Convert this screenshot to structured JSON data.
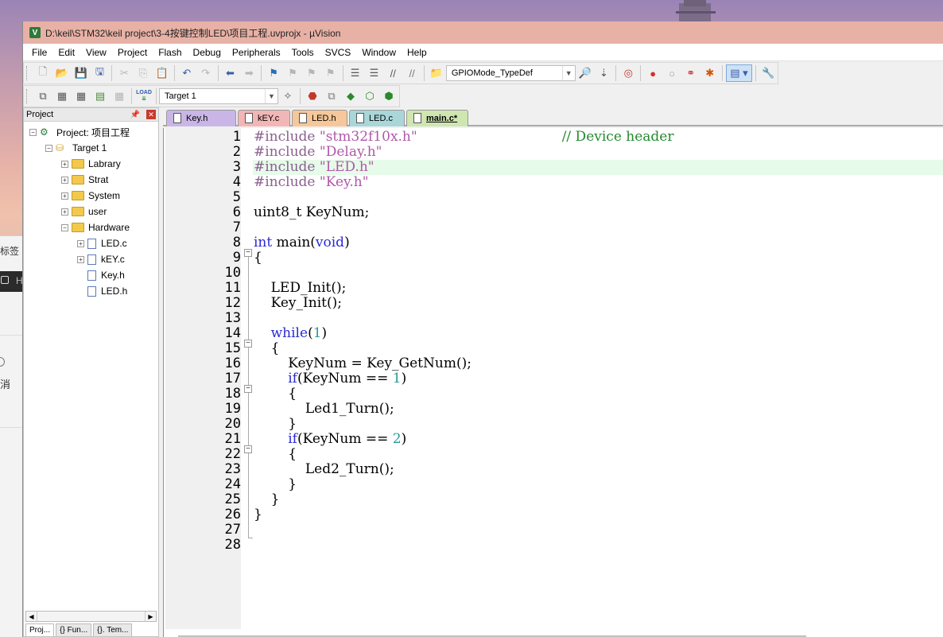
{
  "window": {
    "title": "D:\\keil\\STM32\\keil project\\3-4按键控制LED\\项目工程.uvprojx - µVision",
    "app_icon": "V"
  },
  "background": {
    "text1": "标签",
    "text2": "消",
    "dark_text": "H"
  },
  "menu": [
    "File",
    "Edit",
    "View",
    "Project",
    "Flash",
    "Debug",
    "Peripherals",
    "Tools",
    "SVCS",
    "Window",
    "Help"
  ],
  "toolbar1": {
    "find_combo_value": "GPIOMode_TypeDef",
    "icons": [
      "new-file-icon",
      "open-icon",
      "save-icon",
      "save-all-icon",
      "cut-icon",
      "copy-icon",
      "paste-icon",
      "undo-icon",
      "redo-icon",
      "nav-back-icon",
      "nav-forward-icon",
      "bookmark-icon",
      "prev-bookmark-icon",
      "next-bookmark-icon",
      "clear-bookmarks-icon",
      "indent-icon",
      "unindent-icon",
      "comment-icon",
      "uncomment-icon",
      "find-in-files-icon",
      "find-icon",
      "incremental-find-icon",
      "debug-session-icon",
      "breakpoint-icon",
      "disable-breakpoint-icon",
      "disable-all-breakpoints-icon",
      "kill-breakpoints-icon",
      "window-layout-icon",
      "configure-icon"
    ]
  },
  "toolbar2": {
    "target_combo_value": "Target 1",
    "load_label": "LOAD"
  },
  "project_panel": {
    "title": "Project",
    "root": "Project: 项目工程",
    "target": "Target 1",
    "groups": [
      "Labrary",
      "Strat",
      "System",
      "user",
      "Hardware"
    ],
    "hardware_files": [
      "LED.c",
      "kEY.c",
      "Key.h",
      "LED.h"
    ],
    "bottom_tabs": [
      "Proj...",
      "{} Fun...",
      "{}. Tem..."
    ]
  },
  "editor": {
    "tabs": [
      {
        "label": "Key.h",
        "color": "#c9b6e6"
      },
      {
        "label": "kEY.c",
        "color": "#f2b6b6"
      },
      {
        "label": "LED.h",
        "color": "#f6c79a"
      },
      {
        "label": "LED.c",
        "color": "#a9d6d9"
      },
      {
        "label": "main.c*",
        "color": "#cfe6b0"
      }
    ],
    "active_tab": "main.c*",
    "line_numbers": [
      "1",
      "2",
      "3",
      "4",
      "5",
      "6",
      "7",
      "8",
      "9",
      "10",
      "11",
      "12",
      "13",
      "14",
      "15",
      "16",
      "17",
      "18",
      "19",
      "20",
      "21",
      "22",
      "23",
      "24",
      "25",
      "26",
      "27",
      "28"
    ],
    "highlighted_line": 3,
    "code": {
      "l1_pp": "#include ",
      "l1_str": "\"stm32f10x.h\"",
      "l1_cm": "// Device header",
      "l2_pp": "#include ",
      "l2_str": "\"Delay.h\"",
      "l3_pp": "#include ",
      "l3_str": "\"LED.h\"",
      "l4_pp": "#include ",
      "l4_str": "\"Key.h\"",
      "l6": "uint8_t KeyNum;",
      "l8_kw1": "int",
      "l8_mid": " main(",
      "l8_kw2": "void",
      "l8_end": ")",
      "l9": "{",
      "l11": "    LED_Init();",
      "l12": "    Key_Init();",
      "l14_ind": "    ",
      "l14_kw": "while",
      "l14_a": "(",
      "l14_num": "1",
      "l14_b": ")",
      "l15": "    {",
      "l16": "        KeyNum = Key_GetNum();",
      "l17_ind": "        ",
      "l17_kw": "if",
      "l17_a": "(KeyNum == ",
      "l17_num": "1",
      "l17_b": ")",
      "l18": "        {",
      "l19": "            Led1_Turn();",
      "l20": "        }",
      "l21_ind": "        ",
      "l21_kw": "if",
      "l21_a": "(KeyNum == ",
      "l21_num": "2",
      "l21_b": ")",
      "l22": "        {",
      "l23": "            Led2_Turn();",
      "l24": "        }",
      "l25": "    }",
      "l26": "}"
    }
  }
}
